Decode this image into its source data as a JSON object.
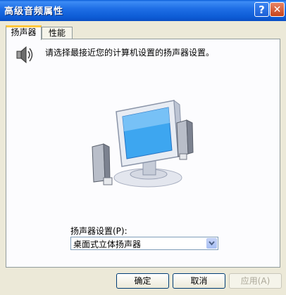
{
  "window": {
    "title": "高级音频属性",
    "help_glyph": "?",
    "close_glyph": "✕"
  },
  "tabs": [
    {
      "label": "扬声器",
      "active": true
    },
    {
      "label": "性能",
      "active": false
    }
  ],
  "panel": {
    "instruction": "请选择最接近您的计算机设置的扬声器设置。",
    "icons": {
      "header": "speaker-icon",
      "illustration": "desktop-stereo-speakers-illustration"
    }
  },
  "speaker_setup": {
    "label": "扬声器设置(P):",
    "selected": "桌面式立体扬声器"
  },
  "buttons": {
    "ok": "确定",
    "cancel": "取消",
    "apply": "应用(A)"
  },
  "colors": {
    "titlebar": "#0a5fd8",
    "dialog_bg": "#ece9d8",
    "panel_bg": "#fcfcfe",
    "active_tab_accent": "#ffc83c",
    "disabled_text": "#aca899"
  }
}
